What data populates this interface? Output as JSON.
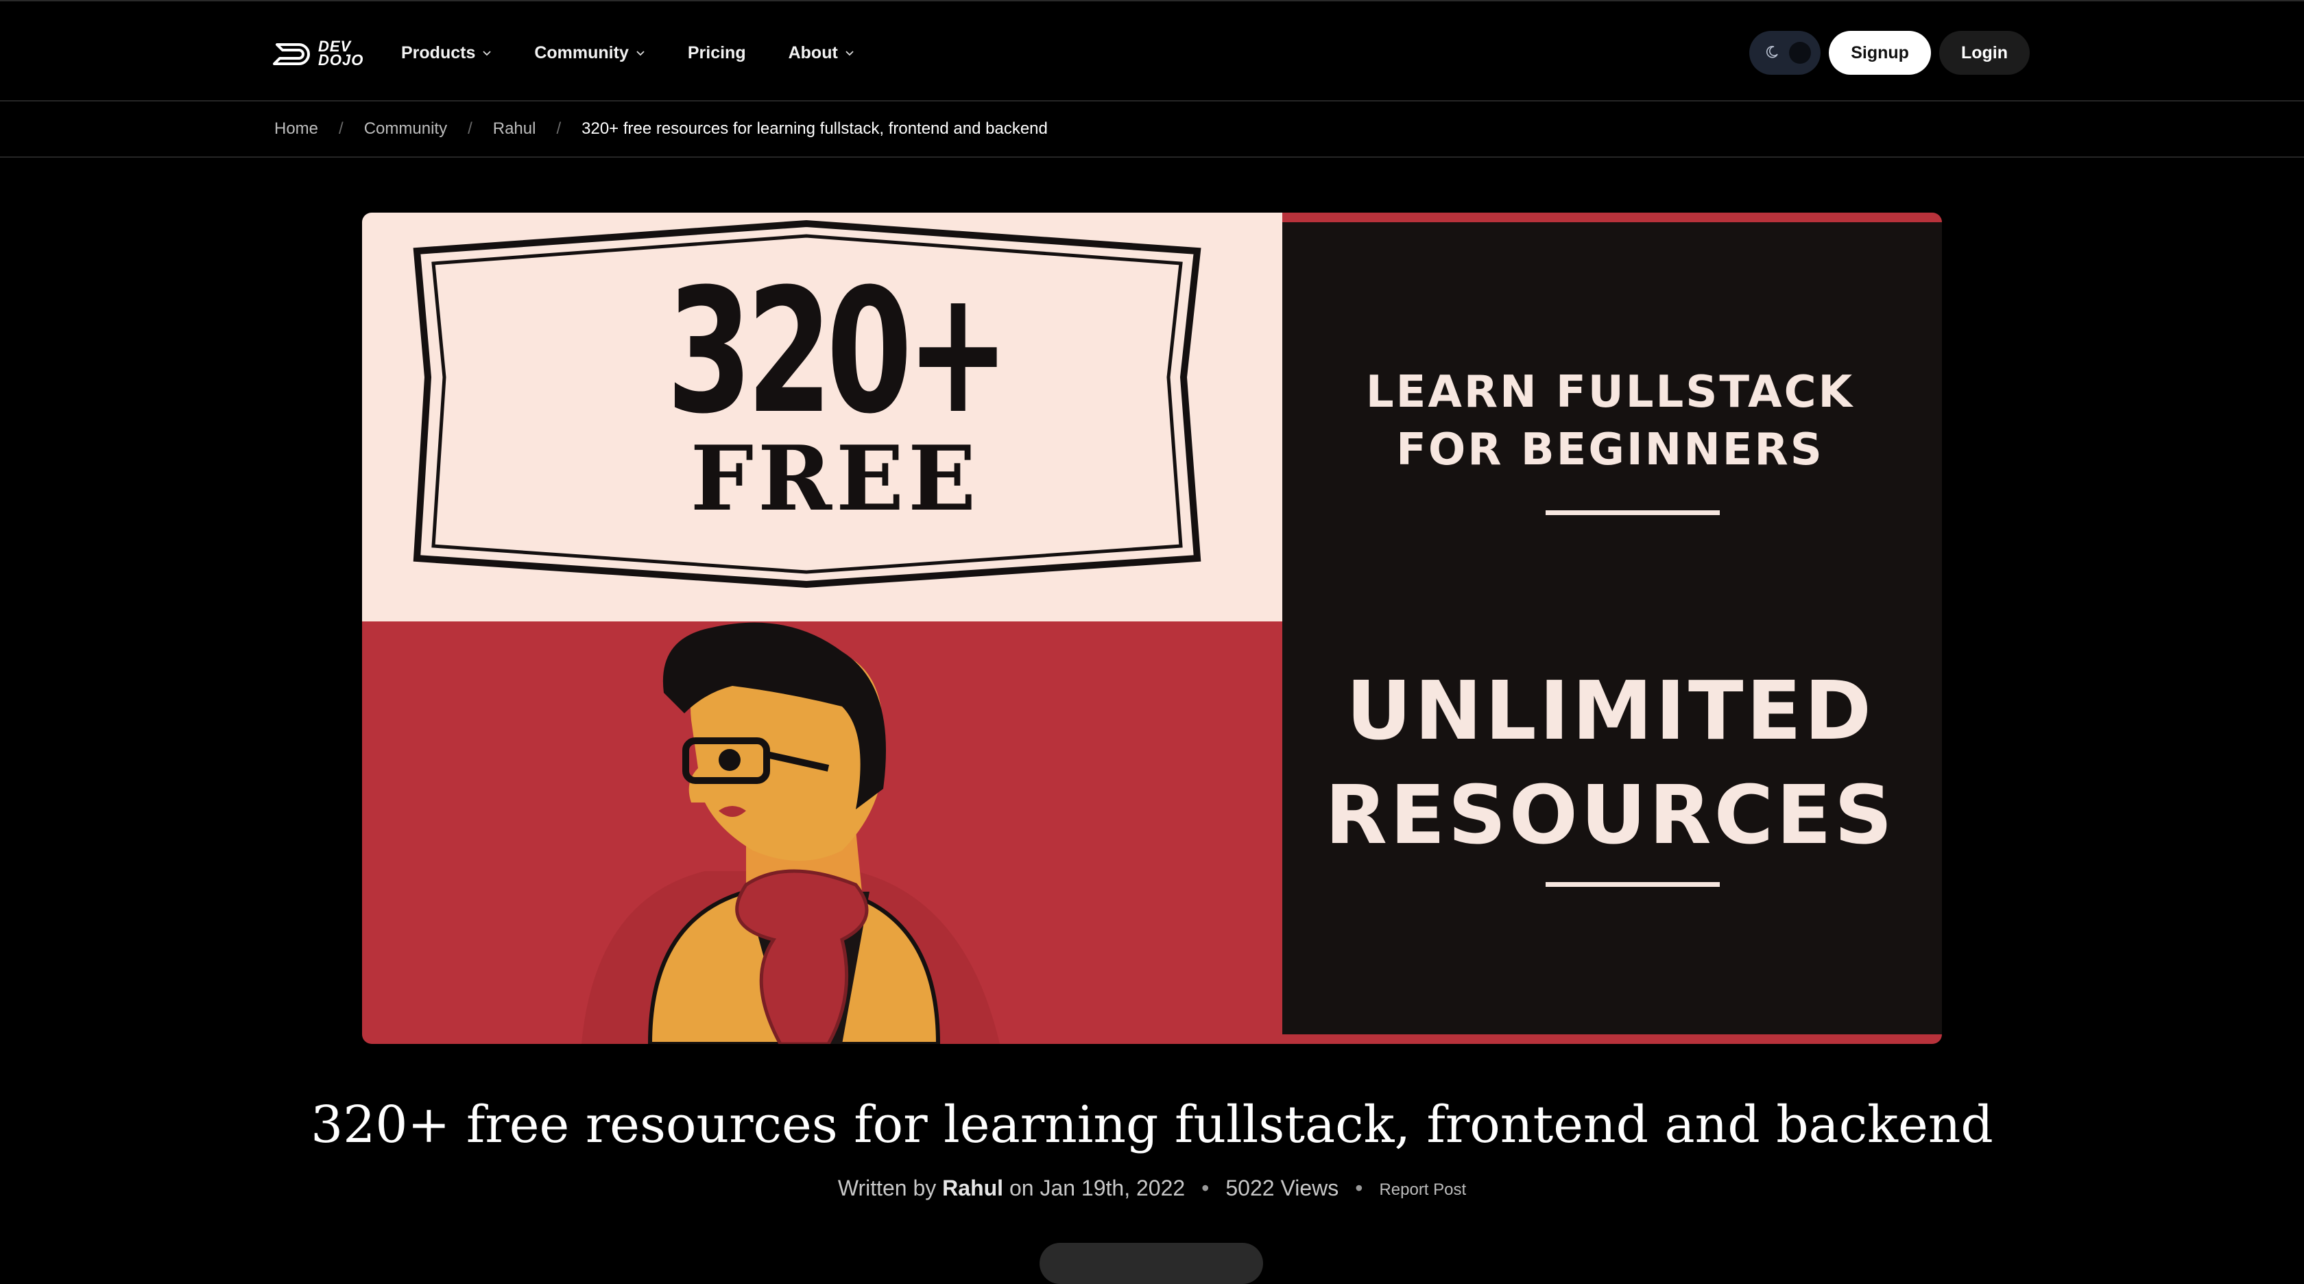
{
  "header": {
    "logo_text_line1": "DEV",
    "logo_text_line2": "DOJO",
    "nav": [
      {
        "label": "Products",
        "dropdown": true
      },
      {
        "label": "Community",
        "dropdown": true
      },
      {
        "label": "Pricing",
        "dropdown": false
      },
      {
        "label": "About",
        "dropdown": true
      }
    ],
    "signup_label": "Signup",
    "login_label": "Login"
  },
  "breadcrumb": [
    "Home",
    "Community",
    "Rahul",
    "320+ free resources for learning fullstack, frontend and backend"
  ],
  "hero": {
    "count": "320+",
    "free": "FREE",
    "learn_line1": "LEARN FULLSTACK",
    "learn_line2": "FOR BEGINNERS",
    "unlimited": "UNLIMITED",
    "resources": "RESOURCES"
  },
  "article": {
    "title": "320+ free resources for learning fullstack, frontend and backend",
    "written_by": "Written by",
    "author": "Rahul",
    "date_prefix": "on",
    "date": "Jan 19th, 2022",
    "views": "5022 Views",
    "report_label": "Report Post"
  },
  "colors": {
    "background": "#000000",
    "hero_cream": "#fbe6dd",
    "hero_red": "#b8323b",
    "hero_dark": "#151110",
    "toggle_bg": "#1e2533"
  }
}
